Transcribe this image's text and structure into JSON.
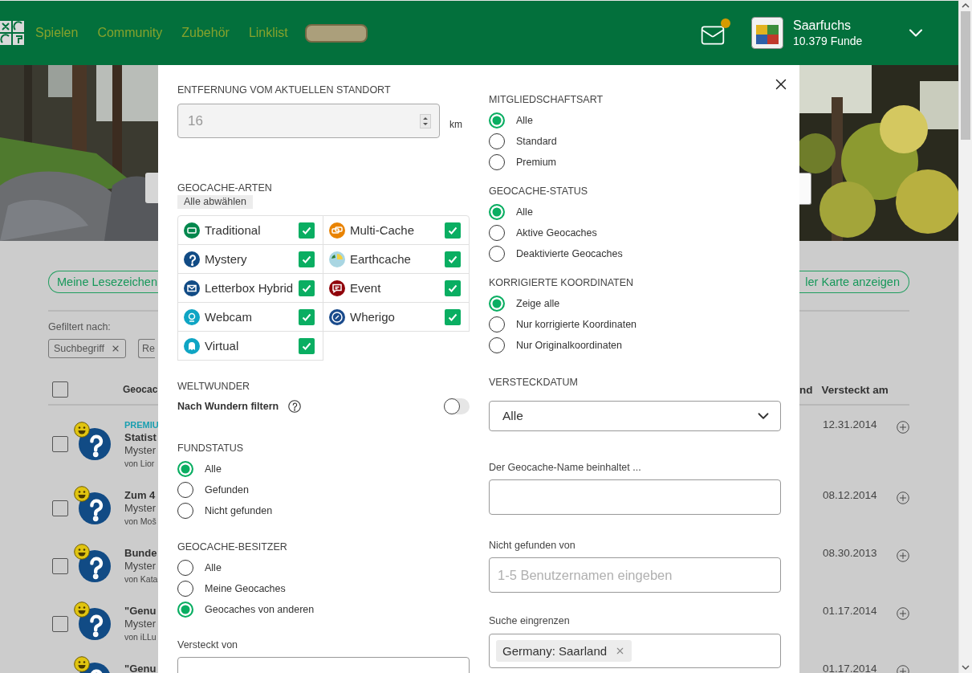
{
  "header": {
    "nav": [
      "Spielen",
      "Community",
      "Zubehör",
      "Linklist"
    ],
    "mail_unread": true,
    "user": {
      "name": "Saarfuchs",
      "finds": "10.379 Funde"
    }
  },
  "page": {
    "bookmarks_button": "Meine Lesezeichen",
    "map_button": "ler Karte anzeigen",
    "filter_label": "Gefiltert nach:",
    "filter_chips": [
      {
        "label": "Suchbegriff",
        "removable": true
      },
      {
        "label": "Re",
        "removable": false
      }
    ],
    "table": {
      "select_all_checked": false,
      "first_column": "Geocac",
      "right_columns": [
        "nd",
        "Versteckt am"
      ],
      "rows": [
        {
          "checked": false,
          "badge": "PREMIU",
          "name": "Statist",
          "type": "Myster",
          "owner": "von Lior",
          "date": "12.31.2014"
        },
        {
          "checked": false,
          "name": "Zum 4",
          "type": "Myster",
          "owner": "von Moš",
          "date": "08.12.2014"
        },
        {
          "checked": false,
          "name": "Bunde",
          "type": "Myster",
          "owner": "von Kata",
          "date": "08.30.2013"
        },
        {
          "checked": false,
          "name": "\"Genu",
          "type": "Myster",
          "owner": "von iLLu",
          "date": "01.17.2014"
        },
        {
          "name": "\"Genu",
          "date": "01.17.2014"
        }
      ]
    }
  },
  "modal": {
    "left": [
      {
        "kind": "distance",
        "title": "ENTFERNUNG VOM AKTUELLEN STANDORT",
        "value": "16",
        "unit": "km"
      },
      {
        "kind": "types",
        "title": "GEOCACHE-ARTEN",
        "deselect_button": "Alle abwählen",
        "types": [
          {
            "kind": "traditional",
            "label": "Traditional",
            "color": "#02874d",
            "checked": true
          },
          {
            "kind": "multi",
            "label": "Multi-Cache",
            "color": "#e98300",
            "checked": true
          },
          {
            "kind": "mystery",
            "label": "Mystery",
            "color": "#114b85",
            "checked": true
          },
          {
            "kind": "earth",
            "label": "Earthcache",
            "color": "#a9d6e2",
            "checked": true
          },
          {
            "kind": "letterbox",
            "label": "Letterbox Hybrid",
            "color": "#114b85",
            "checked": true
          },
          {
            "kind": "event",
            "label": "Event",
            "color": "#90040b",
            "checked": true
          },
          {
            "kind": "webcam",
            "label": "Webcam",
            "color": "#0fa5c4",
            "checked": true
          },
          {
            "kind": "wherigo",
            "label": "Wherigo",
            "color": "#1a4b8c",
            "checked": true
          },
          {
            "kind": "virtual",
            "label": "Virtual",
            "color": "#0fa5c4",
            "checked": true
          }
        ]
      },
      {
        "kind": "toggle",
        "title": "WELTWUNDER",
        "label": "Nach Wundern filtern",
        "on": false
      },
      {
        "kind": "radio",
        "title": "FUNDSTATUS",
        "options": [
          {
            "label": "Alle",
            "selected": true
          },
          {
            "label": "Gefunden",
            "selected": false
          },
          {
            "label": "Nicht gefunden",
            "selected": false
          }
        ]
      },
      {
        "kind": "radio",
        "title": "GEOCACHE-BESITZER",
        "options": [
          {
            "label": "Alle",
            "selected": false
          },
          {
            "label": "Meine Geocaches",
            "selected": false
          },
          {
            "label": "Geocaches von anderen",
            "selected": true
          }
        ]
      },
      {
        "kind": "text",
        "label": "Versteckt von"
      }
    ],
    "right": [
      {
        "kind": "radio",
        "title": "MITGLIEDSCHAFTSART",
        "options": [
          {
            "label": "Alle",
            "selected": true
          },
          {
            "label": "Standard",
            "selected": false
          },
          {
            "label": "Premium",
            "selected": false
          }
        ]
      },
      {
        "kind": "radio",
        "title": "GEOCACHE-STATUS",
        "options": [
          {
            "label": "Alle",
            "selected": true
          },
          {
            "label": "Aktive Geocaches",
            "selected": false
          },
          {
            "label": "Deaktivierte Geocaches",
            "selected": false
          }
        ]
      },
      {
        "kind": "radio",
        "title": "KORRIGIERTE KOORDINATEN",
        "options": [
          {
            "label": "Zeige alle",
            "selected": true
          },
          {
            "label": "Nur korrigierte Koordinaten",
            "selected": false
          },
          {
            "label": "Nur Originalkoordinaten",
            "selected": false
          }
        ]
      },
      {
        "kind": "select",
        "title": "VERSTECKDATUM",
        "value": "Alle"
      },
      {
        "kind": "text",
        "label": "Der Geocache-Name beinhaltet ..."
      },
      {
        "kind": "text",
        "label": "Nicht gefunden von",
        "placeholder": "1-5 Benutzernamen eingeben"
      },
      {
        "kind": "chips",
        "label": "Suche eingrenzen",
        "chips": [
          "Germany: Saarland"
        ]
      }
    ]
  }
}
